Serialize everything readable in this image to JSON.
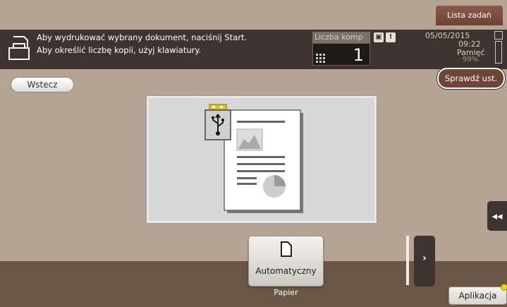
{
  "header": {
    "job_list_label": "Lista zadań"
  },
  "message": {
    "line1": "Aby wydrukować wybrany dokument, naciśnij Start.",
    "line2": "Aby określić liczbę kopii, użyj klawiatury."
  },
  "copies": {
    "label": "Liczba komp",
    "value": "1"
  },
  "status": {
    "date": "05/05/2015",
    "time": "09:22",
    "memory_label": "Pamięć",
    "memory_value": "99%"
  },
  "buttons": {
    "back_label": "Wstecz",
    "check_settings_label": "Sprawdź ust.",
    "paper_label": "Automatyczny",
    "paper_caption": "Papier",
    "next_symbol": "›",
    "side_symbol": "◂◂",
    "application_label": "Aplikacja"
  },
  "icons": {
    "document": "document-print-icon",
    "keypad": "keypad-icon",
    "usb": "usb-icon",
    "warning": "warning-icon",
    "toner": "toner-icon"
  },
  "colors": {
    "brand_accent": "#6e4436",
    "bar_dark": "#3d3430",
    "background": "#b5a493",
    "usb_yellow": "#e0c020"
  }
}
